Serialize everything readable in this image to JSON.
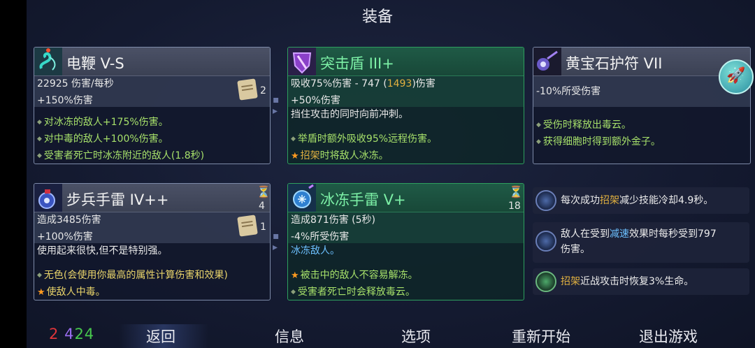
{
  "title": "装备",
  "weapon1": {
    "name": "电鞭 V-S",
    "stat1": "22925 伤害/每秒",
    "stat2": "+150%伤害",
    "scroll_count": "2",
    "perks": [
      "对冰冻的敌人+175%伤害。",
      "对中毒的敌人+100%伤害。",
      "受害者死亡时冰冻附近的敌人(1.8秒)"
    ]
  },
  "shield": {
    "name": "突击盾 III+",
    "stat1_pre": "吸收75%伤害 - 747 (",
    "stat1_hl": "1493",
    "stat1_post": ")伤害",
    "stat2": "+50%伤害",
    "desc": "挡住攻击的同时向前冲刺。",
    "perk1": "举盾时额外吸收95%远程伤害。",
    "perk2_hl": "招架",
    "perk2_rest": "时将敌人冰冻。"
  },
  "amulet": {
    "name": "黄宝石护符 VII",
    "stat1": "-10%所受伤害",
    "perks": [
      "受伤时释放出毒云。",
      "获得细胞时得到额外金子。"
    ]
  },
  "skill1": {
    "name": "步兵手雷 IV++",
    "cooldown": "4",
    "stat1": "造成3485伤害",
    "stat2": "+100%伤害",
    "scroll_count": "1",
    "desc": "使用起来很快,但不是特别强。",
    "perk1": "无色(会使用你最高的属性计算伤害和效果)",
    "perk2": "使敌人中毒。"
  },
  "skill2": {
    "name": "冰冻手雷 V+",
    "cooldown": "18",
    "stat1": "造成871伤害 (5秒)",
    "stat2": "-4%所受伤害",
    "desc": "冰冻敌人。",
    "perk1": "被击中的敌人不容易解冻。",
    "perk2": "受害者死亡时会释放毒云。"
  },
  "mutations": [
    {
      "pre": "每次成功",
      "hl": "招架",
      "post": "减少技能冷却4.9秒。"
    },
    {
      "pre": "敌人在受到",
      "hl": "减速",
      "post": "效果时每秒受到797",
      "line2": "伤害。"
    },
    {
      "pre": "",
      "hl": "招架",
      "post": "近战攻击时恢复3%生命。"
    }
  ],
  "stats": {
    "brutality": "2",
    "tactics": "4",
    "survival": "24"
  },
  "menu": {
    "back": "返回",
    "info": "信息",
    "options": "选项",
    "restart": "重新开始",
    "quit": "退出游戏"
  },
  "colors": {
    "brutality": "#e0353a",
    "tactics": "#9a6cf0",
    "survival": "#47c84d"
  }
}
